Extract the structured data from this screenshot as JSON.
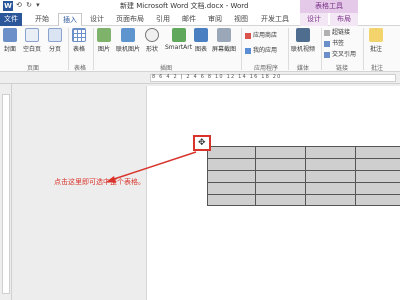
{
  "titlebar": {
    "app_icon": "W",
    "qat": "⟲ ↻ ▾",
    "title": "新建 Microsoft Word 文档.docx - Word",
    "context_group": "表格工具"
  },
  "tabs": {
    "file": "文件",
    "home": "开始",
    "insert": "插入",
    "design": "设计",
    "layout": "页面布局",
    "references": "引用",
    "mailings": "邮件",
    "review": "审阅",
    "view": "视图",
    "developer": "开发工具",
    "table_design": "设计",
    "table_layout": "布局"
  },
  "ribbon": {
    "pages": {
      "cover": "封面",
      "blank": "空白页",
      "break": "分页",
      "label": "页面"
    },
    "tables": {
      "table": "表格",
      "label": "表格"
    },
    "illustrations": {
      "picture": "图片",
      "online_picture": "联机图片",
      "shapes": "形状",
      "smartart": "SmartArt",
      "chart": "图表",
      "screenshot": "屏幕截图",
      "label": "插图"
    },
    "apps": {
      "store": "应用商店",
      "my_apps": "我的应用",
      "label": "应用程序"
    },
    "media": {
      "online_video": "联机视频",
      "label": "媒体"
    },
    "links": {
      "hyperlink": "超链接",
      "bookmark": "书签",
      "cross_reference": "交叉引用",
      "label": "链接"
    },
    "comments": {
      "comment": "批注",
      "label": "批注"
    }
  },
  "ruler": {
    "numbers": "8 6 4 2 | 2 4 6 8 10 12 14 16 18 20"
  },
  "document": {
    "move_handle_glyph": "✥",
    "annotation": "点击这里即可选中整个表格。"
  },
  "colors": {
    "word_blue": "#2b579a",
    "context_purple": "#7a2f87",
    "annotation_red": "#d9342b",
    "table_shade": "#cfcfcf"
  }
}
